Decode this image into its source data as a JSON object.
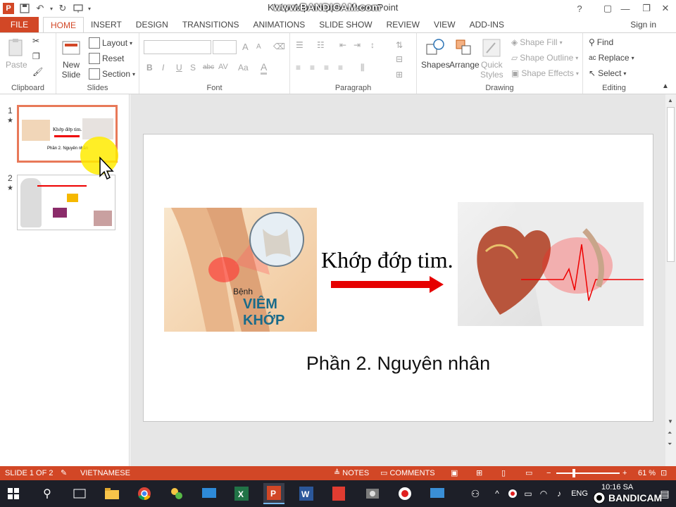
{
  "window": {
    "doc_title": "Khớp đớp tim.pptx - PowerPoint",
    "watermark": "www.BANDICAM.com",
    "controls": [
      "?",
      "▢",
      "—",
      "❐",
      "✕"
    ]
  },
  "tabs": [
    "FILE",
    "HOME",
    "INSERT",
    "DESIGN",
    "TRANSITIONS",
    "ANIMATIONS",
    "SLIDE SHOW",
    "REVIEW",
    "VIEW",
    "ADD-INS"
  ],
  "signin": "Sign in",
  "ribbon": {
    "clipboard": {
      "label": "Clipboard",
      "paste": "Paste"
    },
    "slides": {
      "label": "Slides",
      "new_slide_1": "New",
      "new_slide_2": "Slide",
      "layout": "Layout",
      "reset": "Reset",
      "section": "Section"
    },
    "font": {
      "label": "Font",
      "bold": "B",
      "italic": "I",
      "underline": "U",
      "shadow": "S",
      "strike": "abc",
      "spacing": "AV",
      "case": "Aa",
      "grow": "A",
      "shrink": "A"
    },
    "paragraph": {
      "label": "Paragraph"
    },
    "drawing": {
      "label": "Drawing",
      "shapes": "Shapes",
      "arrange": "Arrange",
      "quick_styles_1": "Quick",
      "quick_styles_2": "Styles",
      "shape_fill": "Shape Fill",
      "shape_outline": "Shape Outline",
      "shape_effects": "Shape Effects"
    },
    "editing": {
      "label": "Editing",
      "find": "Find",
      "replace": "Replace",
      "select": "Select"
    }
  },
  "thumbnails": [
    {
      "number": "1",
      "star": "★",
      "title": "Khớp đớp tim.",
      "subtitle": "Phần 2. Nguyên nhân"
    },
    {
      "number": "2",
      "star": "★"
    }
  ],
  "slide": {
    "knee_image_label_1": "Bệnh",
    "knee_image_label_2": "VIÊM KHỚP",
    "heading": "Khớp đớp tim.",
    "subtitle": "Phần 2. Nguyên nhân"
  },
  "status": {
    "slide_of": "SLIDE 1 OF 2",
    "language": "VIETNAMESE",
    "notes": "NOTES",
    "comments": "COMMENTS",
    "zoom": "61 %"
  },
  "taskbar": {
    "time": "10:16 SA",
    "lang": "ENG",
    "watermark": "BANDICAM"
  }
}
